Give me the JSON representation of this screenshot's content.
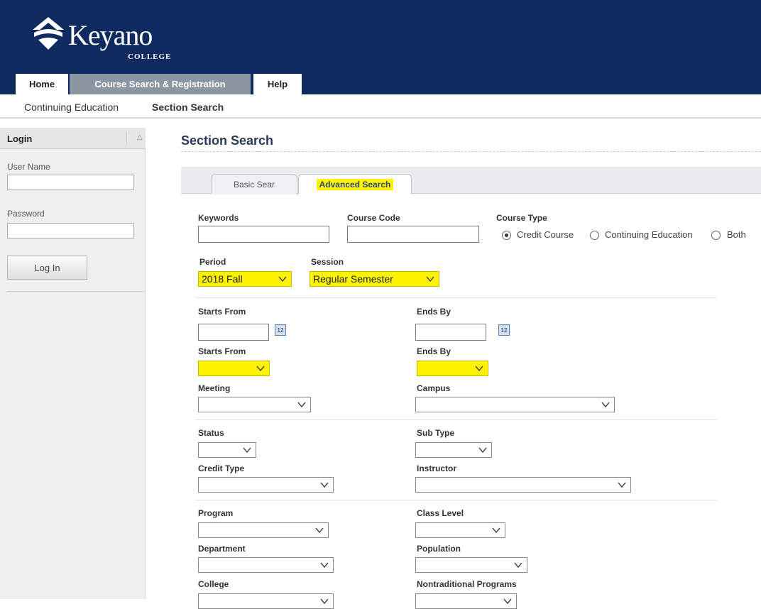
{
  "header": {
    "logo_word": "Keyano",
    "logo_sub": "COLLEGE",
    "tabs": [
      "Home",
      "Course Search & Registration",
      "Help"
    ]
  },
  "subnav": [
    "Continuing Education",
    "Section Search"
  ],
  "login": {
    "title": "Login",
    "collapse_glyph": "△",
    "username_label": "User Name",
    "username_value": "",
    "password_label": "Password",
    "password_value": "",
    "login_button": "Log In"
  },
  "main": {
    "title": "Section Search",
    "tabs": [
      "Basic Sear",
      "Advanced Search"
    ],
    "active_tab": "Advanced Search"
  },
  "form": {
    "keywords": {
      "label": "Keywords",
      "value": ""
    },
    "course_code": {
      "label": "Course Code",
      "value": ""
    },
    "course_type": {
      "label": "Course Type",
      "options": [
        "Credit Course",
        "Continuing Education",
        "Both"
      ],
      "selected": "Credit Course"
    },
    "period": {
      "label": "Period",
      "value": "2018 Fall"
    },
    "session": {
      "label": "Session",
      "value": "Regular Semester"
    },
    "starts_from_date": {
      "label": "Starts From",
      "value": "",
      "calendar_icon_text": "12"
    },
    "ends_by_date": {
      "label": "Ends By",
      "value": "",
      "calendar_icon_text": "12"
    },
    "starts_from_select": {
      "label": "Starts From",
      "value": ""
    },
    "ends_by_select": {
      "label": "Ends By",
      "value": ""
    },
    "meeting": {
      "label": "Meeting",
      "value": ""
    },
    "campus": {
      "label": "Campus",
      "value": ""
    },
    "status": {
      "label": "Status",
      "value": ""
    },
    "sub_type": {
      "label": "Sub Type",
      "value": ""
    },
    "credit_type": {
      "label": "Credit Type",
      "value": ""
    },
    "instructor": {
      "label": "Instructor",
      "value": ""
    },
    "program": {
      "label": "Program",
      "value": ""
    },
    "class_level": {
      "label": "Class Level",
      "value": ""
    },
    "department": {
      "label": "Department",
      "value": ""
    },
    "population": {
      "label": "Population",
      "value": ""
    },
    "college": {
      "label": "College",
      "value": ""
    },
    "nontraditional_programs": {
      "label": "Nontraditional Programs",
      "value": ""
    }
  },
  "colors": {
    "header_bg": "#0f2a5e",
    "highlight": "#fff200",
    "active_tab_bg": "#8c96a3"
  }
}
